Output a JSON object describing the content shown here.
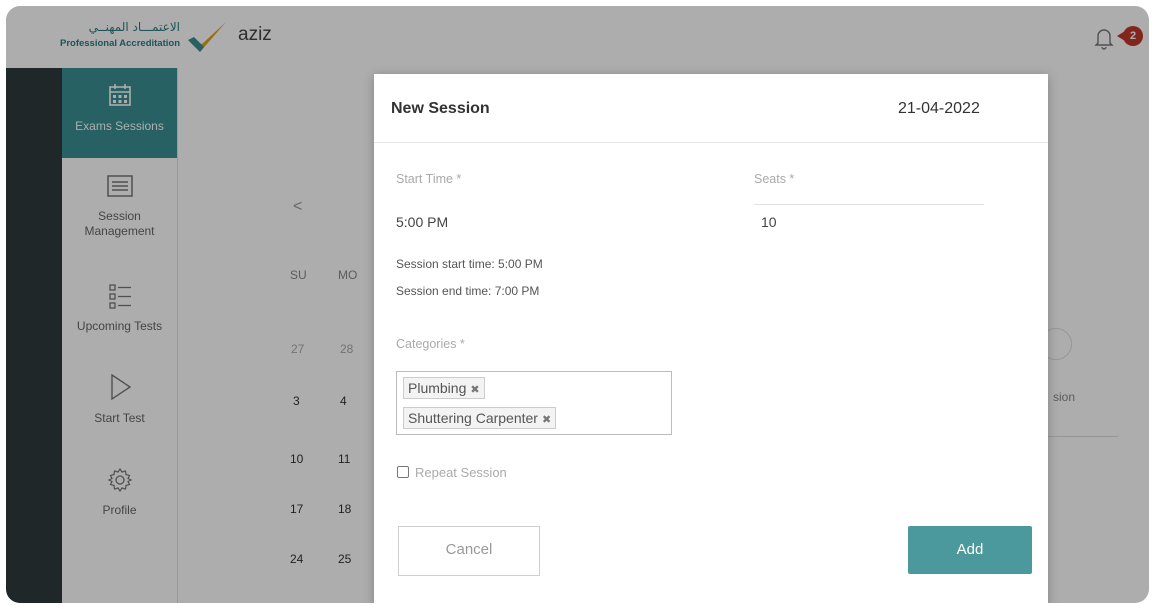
{
  "header": {
    "logo_arabic": "الاعتمـــاد المهنــي",
    "logo_english": "Professional Accreditation",
    "username": "aziz",
    "notification_count": "2"
  },
  "sidebar": {
    "items": [
      {
        "label": "Exams Sessions",
        "icon": "calendar-icon",
        "active": true
      },
      {
        "label_line1": "Session",
        "label_line2": "Management",
        "icon": "list-icon"
      },
      {
        "label": "Upcoming Tests",
        "icon": "checklist-icon"
      },
      {
        "label": "Start Test",
        "icon": "play-icon"
      },
      {
        "label": "Profile",
        "icon": "gear-icon"
      }
    ]
  },
  "calendar": {
    "prev_label": "<",
    "day_headers": [
      "SU",
      "MO"
    ],
    "rows": [
      [
        "27",
        "28"
      ],
      [
        "3",
        "4"
      ],
      [
        "10",
        "11"
      ],
      [
        "17",
        "18"
      ],
      [
        "24",
        "25"
      ]
    ],
    "partial_label": "sion"
  },
  "modal": {
    "title": "New Session",
    "date": "21-04-2022",
    "start_time_label": "Start Time *",
    "start_time_value": "5:00 PM",
    "seats_label": "Seats *",
    "seats_value": "10",
    "session_start_text": "Session start time: 5:00 PM",
    "session_end_text": "Session end time: 7:00 PM",
    "categories_label": "Categories *",
    "categories": [
      "Plumbing",
      "Shuttering Carpenter"
    ],
    "chip_remove": "✖",
    "repeat_label": "Repeat Session",
    "repeat_checked": false,
    "cancel_label": "Cancel",
    "add_label": "Add"
  },
  "colors": {
    "accent": "#4b999d",
    "sidebar_active": "#3a8f93",
    "rail": "#2e3a3c",
    "badge": "#c0392b"
  }
}
